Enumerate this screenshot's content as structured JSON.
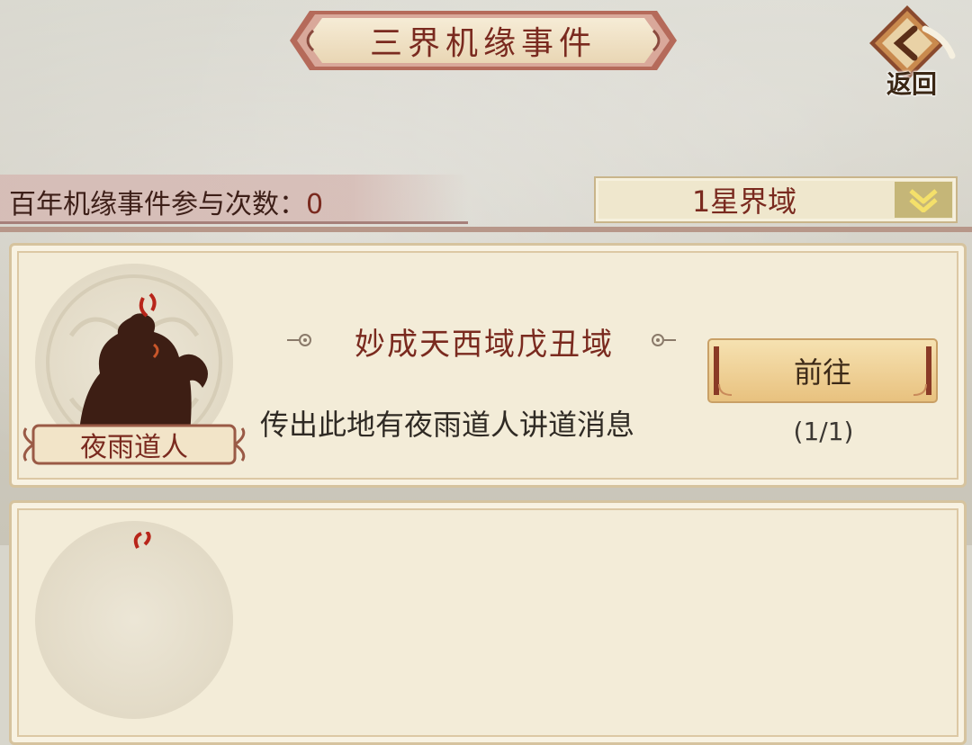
{
  "header": {
    "title": "三界机缘事件",
    "return_label": "返回"
  },
  "background_text": {
    "row1": "",
    "row2": ""
  },
  "stats": {
    "label": "百年机缘事件参与次数：",
    "count": "0"
  },
  "realm_select": {
    "selected": "1星界域"
  },
  "events": [
    {
      "npc_name": "夜雨道人",
      "location": "妙成天西域戊丑域",
      "description": "传出此地有夜雨道人讲道消息",
      "go_label": "前往",
      "progress": "(1/1)"
    }
  ],
  "colors": {
    "title_red": "#7a2a1f",
    "card_bg": "#f3ecd8",
    "go_button": "#f0d59c",
    "accent_gold": "#c5b678"
  }
}
